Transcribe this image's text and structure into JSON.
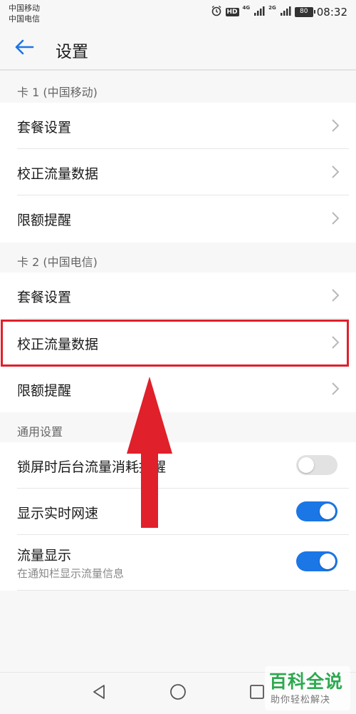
{
  "status_bar": {
    "carrier_1": "中国移动",
    "carrier_2": "中国电信",
    "hd_badge": "HD",
    "sim1_network": "4G",
    "sim2_network": "2G",
    "battery": "80",
    "time": "08:32",
    "icons": [
      "alarm-icon",
      "hd-icon",
      "signal-icon",
      "signal-icon",
      "battery-icon"
    ]
  },
  "header": {
    "title": "设置",
    "back_icon": "arrow-left-icon"
  },
  "sections": {
    "card1": {
      "title": "卡 1 (中国移动)",
      "items": [
        {
          "label": "套餐设置"
        },
        {
          "label": "校正流量数据"
        },
        {
          "label": "限额提醒"
        }
      ]
    },
    "card2": {
      "title": "卡 2 (中国电信)",
      "items": [
        {
          "label": "套餐设置"
        },
        {
          "label": "校正流量数据"
        },
        {
          "label": "限额提醒"
        }
      ]
    },
    "general": {
      "title": "通用设置",
      "items": [
        {
          "label": "锁屏时后台流量消耗提醒",
          "toggle": false
        },
        {
          "label": "显示实时网速",
          "toggle": true
        },
        {
          "label": "流量显示",
          "sublabel": "在通知栏显示流量信息",
          "toggle": true
        }
      ]
    }
  },
  "nav_bar": {
    "icons": [
      "back-triangle-icon",
      "home-circle-icon",
      "recents-square-icon"
    ]
  },
  "watermark": {
    "title": "百科全说",
    "subtitle": "助你轻松解决"
  },
  "colors": {
    "accent": "#1b76e6",
    "highlight": "#e0202a",
    "watermark": "#2da94f"
  }
}
